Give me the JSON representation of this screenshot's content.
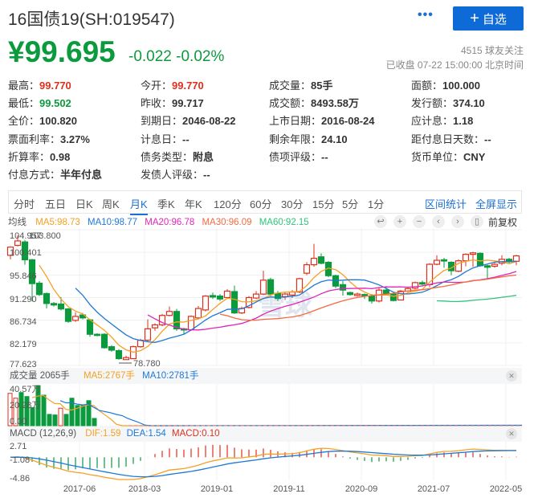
{
  "header": {
    "title": "16国债19(SH:019547)",
    "more": "•••",
    "follow_label": "自选",
    "follow_icon": "+",
    "price": "¥99.695",
    "change": "-0.022",
    "change_pct": "-0.02%",
    "followers": "4515 球友关注",
    "status": "已收盘 07-22 15:00:00 北京时间"
  },
  "quote": [
    [
      {
        "k": "最高：",
        "v": "99.770",
        "c": "red"
      },
      {
        "k": "今开：",
        "v": "99.770",
        "c": "red"
      },
      {
        "k": "成交量：",
        "v": "85手"
      },
      {
        "k": "面额：",
        "v": "100.000"
      }
    ],
    [
      {
        "k": "最低：",
        "v": "99.502",
        "c": "green"
      },
      {
        "k": "昨收：",
        "v": "99.717"
      },
      {
        "k": "成交额：",
        "v": "8493.58万"
      },
      {
        "k": "发行额：",
        "v": "374.10"
      }
    ],
    [
      {
        "k": "全价：",
        "v": "100.820"
      },
      {
        "k": "到期日：",
        "v": "2046-08-22"
      },
      {
        "k": "上市日期：",
        "v": "2016-08-24"
      },
      {
        "k": "应计息：",
        "v": "1.18"
      }
    ],
    [
      {
        "k": "票面利率：",
        "v": "3.27%"
      },
      {
        "k": "计息日：",
        "v": "--"
      },
      {
        "k": "剩余年限：",
        "v": "24.10"
      },
      {
        "k": "距付息日天数：",
        "v": "--"
      }
    ],
    [
      {
        "k": "折算率：",
        "v": "0.98"
      },
      {
        "k": "债务类型：",
        "v": "附息"
      },
      {
        "k": "债项评级：",
        "v": "--"
      },
      {
        "k": "货币单位：",
        "v": "CNY"
      }
    ],
    [
      {
        "k": "付息方式：",
        "v": "半年付息"
      },
      {
        "k": "发债人评级：",
        "v": "--"
      }
    ]
  ],
  "tabs": [
    "分时",
    "五日",
    "日K",
    "周K",
    "月K",
    "季K",
    "年K",
    "120分",
    "60分",
    "30分",
    "15分",
    "5分",
    "1分"
  ],
  "active_tab": "月K",
  "tab_links": [
    "区间统计",
    "全屏显示"
  ],
  "ma_legend": {
    "label": "均线",
    "ma5": "MA5:98.73",
    "ma10": "MA10:98.77",
    "ma20": "MA20:96.78",
    "ma30": "MA30:96.09",
    "ma60": "MA60:92.15"
  },
  "chart_controls": {
    "icons": [
      "undo-icon",
      "zoom-in-icon",
      "zoom-out-icon",
      "pan-left-icon",
      "pan-right-icon",
      "candle-type-icon"
    ],
    "glyphs": [
      "↩",
      "+",
      "−",
      "‹",
      "›",
      "▯"
    ],
    "adjust": "前复权"
  },
  "colors": {
    "up": "#e02f1c",
    "down": "#0b9a3d",
    "ma5": "#f5a023",
    "ma10": "#1e78d8",
    "ma20": "#e024b8",
    "ma30": "#f46a3f",
    "ma60": "#2ec47a"
  },
  "watermark": "雪球",
  "chart_data": {
    "type": "candlestick",
    "period": "monthly",
    "y_ticks": [
      "104.957",
      "100.401",
      "95.846",
      "91.290",
      "86.734",
      "82.179",
      "77.623"
    ],
    "ylim": [
      77.623,
      104.957
    ],
    "max_label": "103.800",
    "min_label": "78.780",
    "x_labels": [
      "2017-06",
      "2018-03",
      "2019-01",
      "2019-11",
      "2020-09",
      "2021-07",
      "2022-05"
    ],
    "x_label_index": [
      9,
      18,
      28,
      38,
      48,
      58,
      68
    ],
    "ohlc": [
      [
        99.8,
        101.45,
        101.6,
        99.0
      ],
      [
        101.8,
        102.7,
        103.8,
        101.6
      ],
      [
        102.5,
        98.9,
        102.9,
        97.9
      ],
      [
        98.9,
        94.1,
        99.1,
        90.5
      ],
      [
        94.2,
        91.9,
        94.6,
        91.6
      ],
      [
        92.1,
        90.1,
        92.3,
        89.1
      ],
      [
        90.1,
        89.8,
        90.4,
        89.5
      ],
      [
        90.0,
        89.0,
        91.4,
        88.7
      ],
      [
        89.0,
        86.5,
        89.2,
        86.2
      ],
      [
        86.7,
        87.5,
        88.3,
        86.4
      ],
      [
        87.8,
        87.2,
        88.2,
        86.9
      ],
      [
        86.8,
        83.9,
        87.0,
        83.4
      ],
      [
        83.9,
        83.7,
        84.1,
        83.5
      ],
      [
        83.9,
        81.2,
        84.1,
        81.0
      ],
      [
        81.4,
        80.7,
        81.7,
        80.4
      ],
      [
        80.6,
        79.0,
        80.9,
        78.78
      ],
      [
        78.8,
        79.2,
        79.6,
        78.8
      ],
      [
        79.0,
        81.4,
        81.6,
        78.9
      ],
      [
        81.4,
        82.7,
        83.0,
        81.2
      ],
      [
        82.7,
        85.0,
        86.9,
        82.5
      ],
      [
        85.2,
        85.8,
        86.1,
        84.6
      ],
      [
        85.8,
        87.7,
        88.0,
        85.5
      ],
      [
        87.7,
        88.5,
        89.5,
        87.5
      ],
      [
        88.5,
        85.0,
        89.0,
        84.6
      ],
      [
        85.0,
        84.8,
        85.2,
        84.0
      ],
      [
        84.8,
        87.5,
        87.7,
        84.6
      ],
      [
        87.2,
        89.1,
        89.6,
        87.0
      ],
      [
        88.8,
        91.6,
        91.8,
        88.5
      ],
      [
        91.7,
        91.4,
        92.3,
        91.0
      ],
      [
        91.6,
        91.0,
        92.0,
        90.6
      ],
      [
        91.3,
        92.6,
        93.0,
        91.1
      ],
      [
        92.5,
        88.2,
        93.7,
        88.0
      ],
      [
        88.2,
        89.1,
        89.5,
        88.0
      ],
      [
        89.3,
        91.3,
        91.6,
        89.1
      ],
      [
        91.2,
        92.0,
        92.6,
        91.0
      ],
      [
        92.0,
        94.8,
        96.7,
        91.8
      ],
      [
        94.9,
        92.0,
        95.3,
        91.6
      ],
      [
        92.1,
        91.1,
        92.6,
        90.6
      ],
      [
        91.5,
        92.0,
        92.4,
        90.8
      ],
      [
        91.8,
        92.4,
        92.8,
        91.2
      ],
      [
        92.4,
        95.1,
        95.3,
        92.2
      ],
      [
        96.2,
        97.9,
        98.4,
        95.8
      ],
      [
        97.9,
        99.2,
        102.1,
        97.5
      ],
      [
        99.5,
        98.2,
        100.2,
        98.0
      ],
      [
        98.4,
        95.7,
        98.6,
        95.4
      ],
      [
        95.7,
        93.6,
        95.9,
        93.2
      ],
      [
        93.9,
        92.8,
        94.6,
        91.7
      ],
      [
        92.3,
        91.9,
        92.5,
        91.7
      ],
      [
        91.7,
        92.0,
        92.3,
        91.5
      ],
      [
        91.9,
        91.7,
        92.1,
        91.0
      ],
      [
        91.6,
        90.6,
        92.0,
        90.1
      ],
      [
        90.6,
        92.8,
        93.3,
        90.3
      ],
      [
        92.8,
        92.0,
        93.6,
        91.8
      ],
      [
        92.0,
        90.7,
        92.2,
        90.5
      ],
      [
        90.8,
        92.6,
        92.8,
        90.7
      ],
      [
        92.6,
        93.1,
        93.5,
        92.4
      ],
      [
        93.2,
        94.3,
        94.5,
        93.0
      ],
      [
        94.3,
        94.0,
        94.7,
        93.6
      ],
      [
        93.9,
        98.0,
        98.2,
        93.4
      ],
      [
        98.0,
        98.8,
        99.8,
        97.8
      ],
      [
        98.9,
        98.7,
        99.3,
        97.3
      ],
      [
        98.4,
        96.7,
        98.6,
        95.8
      ],
      [
        96.6,
        98.7,
        99.0,
        96.4
      ],
      [
        98.7,
        100.0,
        100.2,
        97.6
      ],
      [
        100.0,
        100.3,
        100.5,
        97.5
      ],
      [
        100.2,
        97.7,
        100.4,
        97.5
      ],
      [
        97.7,
        97.4,
        97.9,
        95.2
      ],
      [
        97.6,
        98.0,
        98.3,
        97.3
      ],
      [
        98.2,
        99.0,
        99.8,
        97.8
      ],
      [
        99.0,
        98.5,
        99.3,
        98.2
      ],
      [
        98.6,
        99.695,
        99.9,
        97.8
      ]
    ],
    "volume": {
      "header": "成交量 2065手",
      "ma5": "MA5:2767手",
      "ma10": "MA10:2781手",
      "y_ticks": [
        "40.57万",
        "20.28万",
        "0.00"
      ],
      "max": 40.57,
      "values_wan": [
        35.5,
        30.2,
        36.4,
        32,
        19.8,
        44,
        33.5,
        12.4,
        11.8,
        19.2,
        12.4,
        30.2,
        22.2,
        22.8,
        27.5,
        8
      ]
    },
    "macd": {
      "header": "MACD (12,26,9)",
      "dif": "DIF:1.59",
      "dea": "DEA:1.54",
      "macd": "MACD:0.10",
      "y_ticks": [
        "2.71",
        "-1.08",
        "-4.86"
      ],
      "ylim": [
        -4.86,
        2.71
      ]
    }
  }
}
